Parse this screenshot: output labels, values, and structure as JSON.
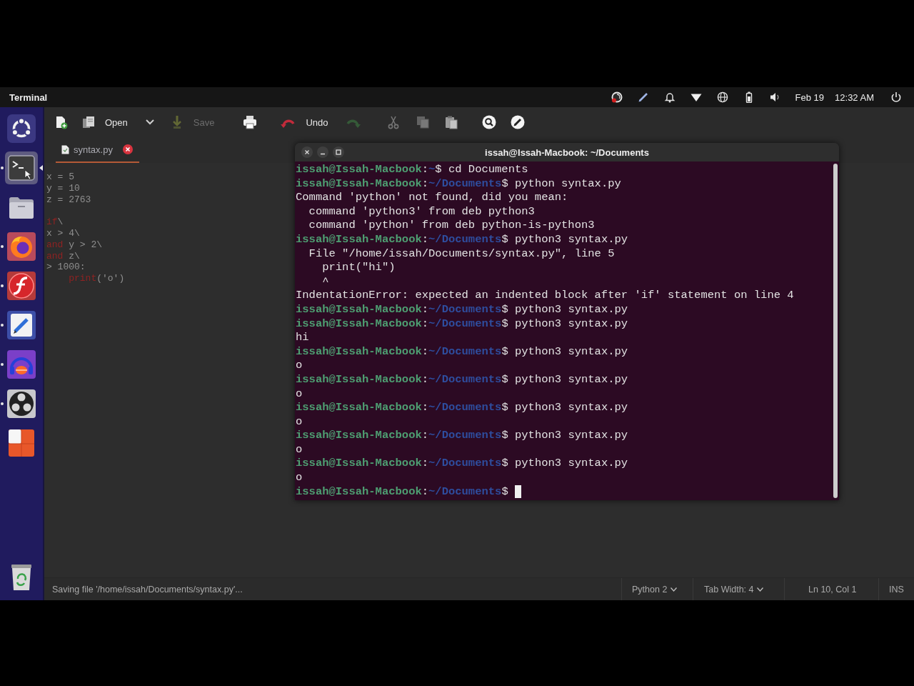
{
  "top_bar": {
    "app_name": "Terminal",
    "date": "Feb 19",
    "time": "12:32 AM"
  },
  "dock": {
    "apps": [
      {
        "kind": "ubuntu",
        "running": false,
        "selected": false
      },
      {
        "kind": "terminal",
        "running": true,
        "selected": true
      },
      {
        "kind": "files",
        "running": false,
        "selected": false
      },
      {
        "kind": "browser",
        "running": true,
        "selected": false
      },
      {
        "kind": "flash",
        "running": true,
        "selected": false
      },
      {
        "kind": "text_editor",
        "running": true,
        "selected": false
      },
      {
        "kind": "audio_recorder",
        "running": true,
        "selected": false
      },
      {
        "kind": "obs",
        "running": true,
        "selected": false
      },
      {
        "kind": "presentation",
        "running": false,
        "selected": false
      }
    ]
  },
  "editor": {
    "toolbar": [
      {
        "kind": "new",
        "disabled": false
      },
      {
        "kind": "open",
        "label": "Open",
        "disabled": false
      },
      {
        "kind": "open_menu",
        "disabled": false
      },
      {
        "kind": "save",
        "label": "Save",
        "disabled": true
      },
      {
        "kind": "print",
        "disabled": false
      },
      {
        "kind": "undo",
        "label": "Undo",
        "disabled": false
      },
      {
        "kind": "redo",
        "disabled": true
      },
      {
        "kind": "cut",
        "disabled": true
      },
      {
        "kind": "copy",
        "disabled": true
      },
      {
        "kind": "paste",
        "disabled": false
      },
      {
        "kind": "find",
        "disabled": false
      },
      {
        "kind": "replace",
        "disabled": false
      }
    ],
    "tabs": [
      {
        "label": "syntax.py",
        "selected": true
      }
    ],
    "code_lines": [
      {
        "kind": "code",
        "segments": [
          {
            "kind": "text",
            "text": "x = 5"
          }
        ]
      },
      {
        "kind": "code",
        "segments": [
          {
            "kind": "text",
            "text": "y = 10"
          }
        ]
      },
      {
        "kind": "code",
        "segments": [
          {
            "kind": "text",
            "text": "z = 2763"
          }
        ]
      },
      {
        "kind": "blank"
      },
      {
        "kind": "code",
        "segments": [
          {
            "kind": "keyword",
            "text": "if"
          },
          {
            "kind": "text",
            "text": "\\"
          }
        ]
      },
      {
        "kind": "code",
        "segments": [
          {
            "kind": "text",
            "text": "x > 4\\"
          }
        ]
      },
      {
        "kind": "code",
        "segments": [
          {
            "kind": "keyword",
            "text": "and"
          },
          {
            "kind": "text",
            "text": " y > 2\\"
          }
        ]
      },
      {
        "kind": "code",
        "segments": [
          {
            "kind": "keyword",
            "text": "and"
          },
          {
            "kind": "text",
            "text": " z\\"
          }
        ]
      },
      {
        "kind": "code",
        "segments": [
          {
            "kind": "text",
            "text": "> 1000:"
          }
        ]
      },
      {
        "kind": "code",
        "segments": [
          {
            "kind": "keyword",
            "text": "    print"
          },
          {
            "kind": "text",
            "text": "('o')"
          }
        ]
      }
    ],
    "status_bar": {
      "message": "Saving file '/home/issah/Documents/syntax.py'...",
      "language": "Python 2",
      "tab_width": "Tab Width: 4",
      "position": "Ln 10, Col 1",
      "mode": "INS"
    }
  },
  "terminal": {
    "title": "issah@Issah-Macbook: ~/Documents",
    "lines": [
      {
        "segments": [
          {
            "kind": "user",
            "text": "issah@Issah-Macbook"
          },
          {
            "kind": "plain",
            "text": ":"
          },
          {
            "kind": "path",
            "text": "~"
          },
          {
            "kind": "plain",
            "text": "$ cd Documents"
          }
        ]
      },
      {
        "segments": [
          {
            "kind": "user",
            "text": "issah@Issah-Macbook"
          },
          {
            "kind": "plain",
            "text": ":"
          },
          {
            "kind": "path",
            "text": "~/Documents"
          },
          {
            "kind": "plain",
            "text": "$ python syntax.py"
          }
        ]
      },
      {
        "segments": [
          {
            "kind": "plain",
            "text": "Command 'python' not found, did you mean:"
          }
        ]
      },
      {
        "segments": [
          {
            "kind": "plain",
            "text": "  command 'python3' from deb python3"
          }
        ]
      },
      {
        "segments": [
          {
            "kind": "plain",
            "text": "  command 'python' from deb python-is-python3"
          }
        ]
      },
      {
        "segments": [
          {
            "kind": "user",
            "text": "issah@Issah-Macbook"
          },
          {
            "kind": "plain",
            "text": ":"
          },
          {
            "kind": "path",
            "text": "~/Documents"
          },
          {
            "kind": "plain",
            "text": "$ python3 syntax.py"
          }
        ]
      },
      {
        "segments": [
          {
            "kind": "plain",
            "text": "  File \"/home/issah/Documents/syntax.py\", line 5"
          }
        ]
      },
      {
        "segments": [
          {
            "kind": "plain",
            "text": "    print(\"hi\")"
          }
        ]
      },
      {
        "segments": [
          {
            "kind": "plain",
            "text": "    ^"
          }
        ]
      },
      {
        "segments": [
          {
            "kind": "plain",
            "text": "IndentationError: expected an indented block after 'if' statement on line 4"
          }
        ]
      },
      {
        "segments": [
          {
            "kind": "user",
            "text": "issah@Issah-Macbook"
          },
          {
            "kind": "plain",
            "text": ":"
          },
          {
            "kind": "path",
            "text": "~/Documents"
          },
          {
            "kind": "plain",
            "text": "$ python3 syntax.py"
          }
        ]
      },
      {
        "segments": [
          {
            "kind": "user",
            "text": "issah@Issah-Macbook"
          },
          {
            "kind": "plain",
            "text": ":"
          },
          {
            "kind": "path",
            "text": "~/Documents"
          },
          {
            "kind": "plain",
            "text": "$ python3 syntax.py"
          }
        ]
      },
      {
        "segments": [
          {
            "kind": "plain",
            "text": "hi"
          }
        ]
      },
      {
        "segments": [
          {
            "kind": "user",
            "text": "issah@Issah-Macbook"
          },
          {
            "kind": "plain",
            "text": ":"
          },
          {
            "kind": "path",
            "text": "~/Documents"
          },
          {
            "kind": "plain",
            "text": "$ python3 syntax.py"
          }
        ]
      },
      {
        "segments": [
          {
            "kind": "plain",
            "text": "o"
          }
        ]
      },
      {
        "segments": [
          {
            "kind": "user",
            "text": "issah@Issah-Macbook"
          },
          {
            "kind": "plain",
            "text": ":"
          },
          {
            "kind": "path",
            "text": "~/Documents"
          },
          {
            "kind": "plain",
            "text": "$ python3 syntax.py"
          }
        ]
      },
      {
        "segments": [
          {
            "kind": "plain",
            "text": "o"
          }
        ]
      },
      {
        "segments": [
          {
            "kind": "user",
            "text": "issah@Issah-Macbook"
          },
          {
            "kind": "plain",
            "text": ":"
          },
          {
            "kind": "path",
            "text": "~/Documents"
          },
          {
            "kind": "plain",
            "text": "$ python3 syntax.py"
          }
        ]
      },
      {
        "segments": [
          {
            "kind": "plain",
            "text": "o"
          }
        ]
      },
      {
        "segments": [
          {
            "kind": "user",
            "text": "issah@Issah-Macbook"
          },
          {
            "kind": "plain",
            "text": ":"
          },
          {
            "kind": "path",
            "text": "~/Documents"
          },
          {
            "kind": "plain",
            "text": "$ python3 syntax.py"
          }
        ]
      },
      {
        "segments": [
          {
            "kind": "plain",
            "text": "o"
          }
        ]
      },
      {
        "segments": [
          {
            "kind": "user",
            "text": "issah@Issah-Macbook"
          },
          {
            "kind": "plain",
            "text": ":"
          },
          {
            "kind": "path",
            "text": "~/Documents"
          },
          {
            "kind": "plain",
            "text": "$ python3 syntax.py"
          }
        ]
      },
      {
        "segments": [
          {
            "kind": "plain",
            "text": "o"
          }
        ]
      },
      {
        "segments": [
          {
            "kind": "user",
            "text": "issah@Issah-Macbook"
          },
          {
            "kind": "plain",
            "text": ":"
          },
          {
            "kind": "path",
            "text": "~/Documents"
          },
          {
            "kind": "plain",
            "text": "$"
          }
        ]
      }
    ]
  }
}
